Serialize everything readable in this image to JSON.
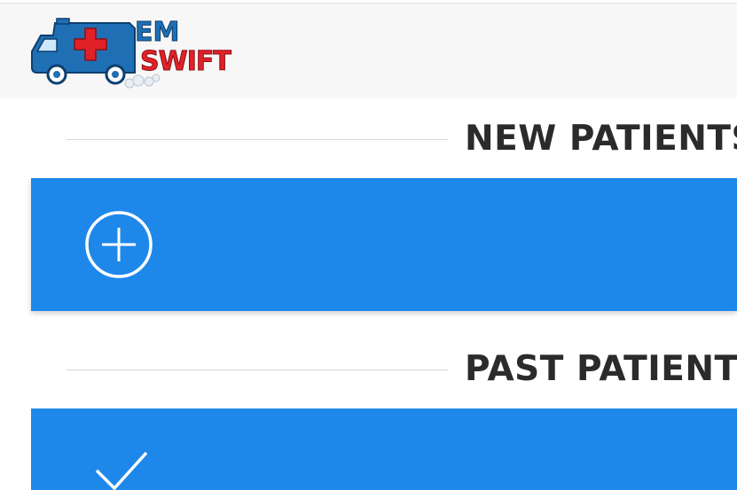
{
  "logo": {
    "line1": "EM",
    "line2": "SWIFT",
    "icon": "ambulance-icon",
    "colors": {
      "blue": "#1f6fb5",
      "red": "#e02228"
    }
  },
  "sections": {
    "new_patients": {
      "title": "NEW PATIENTS",
      "action_icon": "plus-circle-icon"
    },
    "past_patients": {
      "title": "PAST PATIENTS",
      "action_icon": "checkmark-icon"
    }
  },
  "colors": {
    "card_blue": "#1e88ea",
    "header_bg": "#f7f7f7",
    "title_text": "#2b2b2b"
  }
}
